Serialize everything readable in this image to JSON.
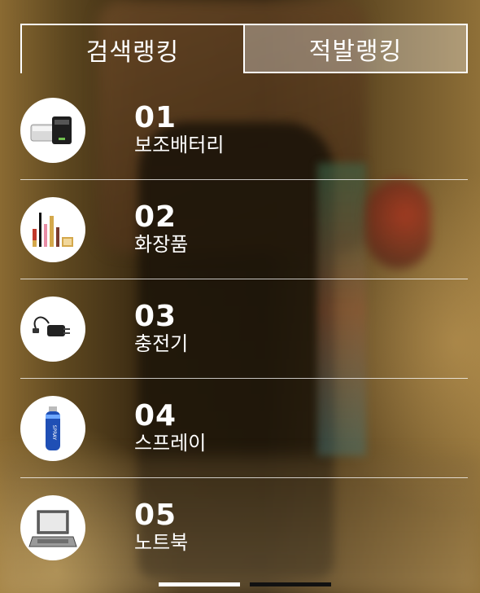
{
  "tabs": [
    {
      "label": "검색랭킹",
      "active": true
    },
    {
      "label": "적발랭킹",
      "active": false
    }
  ],
  "items": [
    {
      "rank": "01",
      "name": "보조배터리",
      "icon": "power-bank-icon"
    },
    {
      "rank": "02",
      "name": "화장품",
      "icon": "cosmetics-icon"
    },
    {
      "rank": "03",
      "name": "충전기",
      "icon": "charger-icon"
    },
    {
      "rank": "04",
      "name": "스프레이",
      "icon": "spray-icon"
    },
    {
      "rank": "05",
      "name": "노트북",
      "icon": "laptop-icon"
    }
  ],
  "spray_can_text": "SPRAY",
  "pager": {
    "pages": 2,
    "current": 1
  },
  "colors": {
    "text": "#ffffff",
    "inactive_tab_bg": "rgba(255,255,255,0.32)",
    "pager_on": "#ffffff",
    "pager_off": "#111111"
  }
}
